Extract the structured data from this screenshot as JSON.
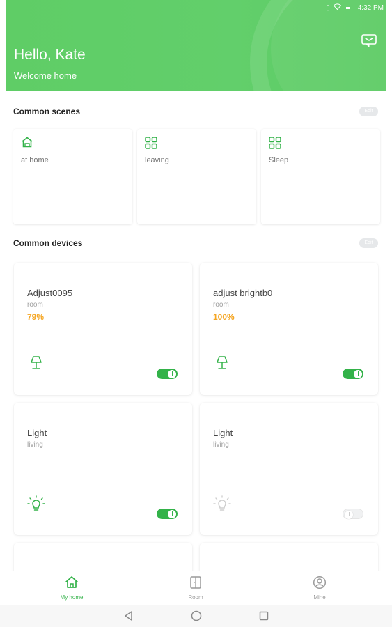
{
  "status_bar": {
    "time": "4:32 PM"
  },
  "header": {
    "greeting": "Hello, Kate",
    "subtitle": "Welcome home",
    "background_color": "#5fcd66"
  },
  "scenes": {
    "title": "Common scenes",
    "edit_label": "Edit",
    "items": [
      {
        "label": "at home",
        "icon": "home-scene-icon"
      },
      {
        "label": "leaving",
        "icon": "grid-scene-icon"
      },
      {
        "label": "Sleep",
        "icon": "grid-scene-icon"
      }
    ]
  },
  "devices": {
    "title": "Common devices",
    "edit_label": "Edit",
    "items": [
      {
        "name": "Adjust0095",
        "room": "room",
        "level": "79%",
        "icon": "lamp-icon",
        "on": true
      },
      {
        "name": "adjust brightb0",
        "room": "room",
        "level": "100%",
        "icon": "lamp-icon",
        "on": true
      },
      {
        "name": "Light",
        "room": "living",
        "level": "",
        "icon": "bulb-icon",
        "on": true
      },
      {
        "name": "Light",
        "room": "living",
        "level": "",
        "icon": "bulb-icon",
        "on": false
      }
    ]
  },
  "bottom_nav": {
    "items": [
      {
        "label": "My home",
        "icon": "home-icon",
        "active": true
      },
      {
        "label": "Room",
        "icon": "room-icon",
        "active": false
      },
      {
        "label": "Mine",
        "icon": "profile-icon",
        "active": false
      }
    ]
  },
  "colors": {
    "accent": "#33b249",
    "level": "#f5a623",
    "header": "#5fcd66"
  }
}
